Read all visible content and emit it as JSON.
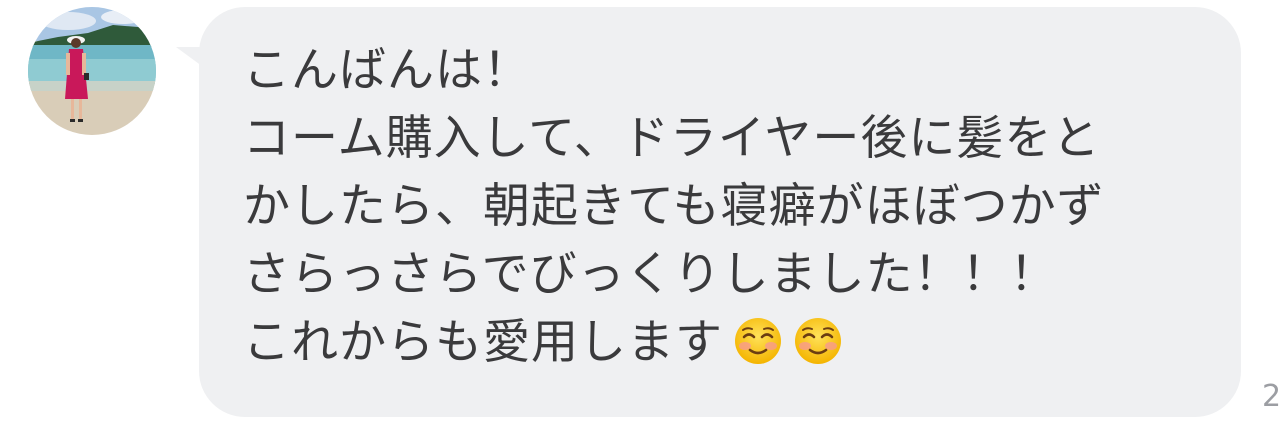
{
  "avatar": {
    "icon": "user-avatar-photo"
  },
  "message": {
    "lines": [
      "こんばんは！",
      "コーム購入して、ドライヤー後に髪をと",
      "かしたら、朝起きても寝癖がほぼつかず",
      "さらっさらでびっくりしました！！！",
      "これからも愛用します"
    ],
    "trailing_emoji": [
      "smiling-face-emoji",
      "smiling-face-emoji"
    ],
    "bubble_color": "#eff0f2",
    "text_color": "#3a3a3c"
  },
  "timestamp": {
    "text": "2"
  }
}
